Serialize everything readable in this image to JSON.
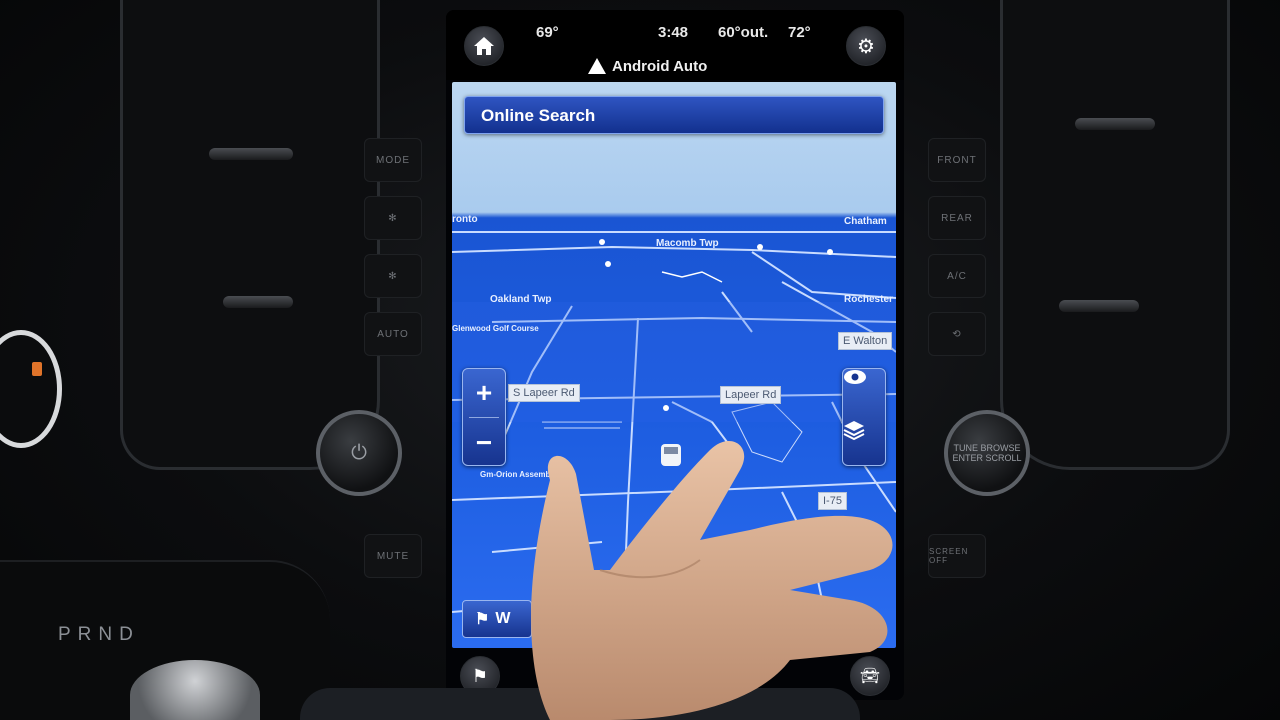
{
  "status": {
    "temp_left": "69°",
    "clock": "3:48",
    "outside_temp": "60°out.",
    "temp_right": "72°"
  },
  "header": {
    "app_title": "Android Auto"
  },
  "search": {
    "label": "Online Search"
  },
  "map": {
    "places": [
      {
        "name": "ronto"
      },
      {
        "name": "Macomb Twp"
      },
      {
        "name": "Chatham"
      },
      {
        "name": "Oakland Twp"
      },
      {
        "name": "Rochester"
      },
      {
        "name": "Glenwood Golf Course"
      },
      {
        "name": "Gm-Orion Assembly"
      }
    ],
    "roads": [
      {
        "name": "S Lapeer Rd"
      },
      {
        "name": "Lapeer Rd"
      },
      {
        "name": "E Walton"
      },
      {
        "name": "I-75"
      }
    ]
  },
  "controls": {
    "zoom_in": "+",
    "zoom_out": "−",
    "where_to": "W"
  },
  "dash": {
    "gear_indicator": "PRND",
    "left_buttons": [
      "MODE",
      "AUTO",
      "MUTE"
    ],
    "right_buttons": [
      "FRONT",
      "REAR",
      "A/C",
      "SCREEN OFF"
    ],
    "right_knob": "TUNE BROWSE ENTER SCROLL"
  },
  "colors": {
    "map_water": "#1d5de0",
    "map_road": "#c9dcff",
    "ui_button": "#17348f"
  }
}
